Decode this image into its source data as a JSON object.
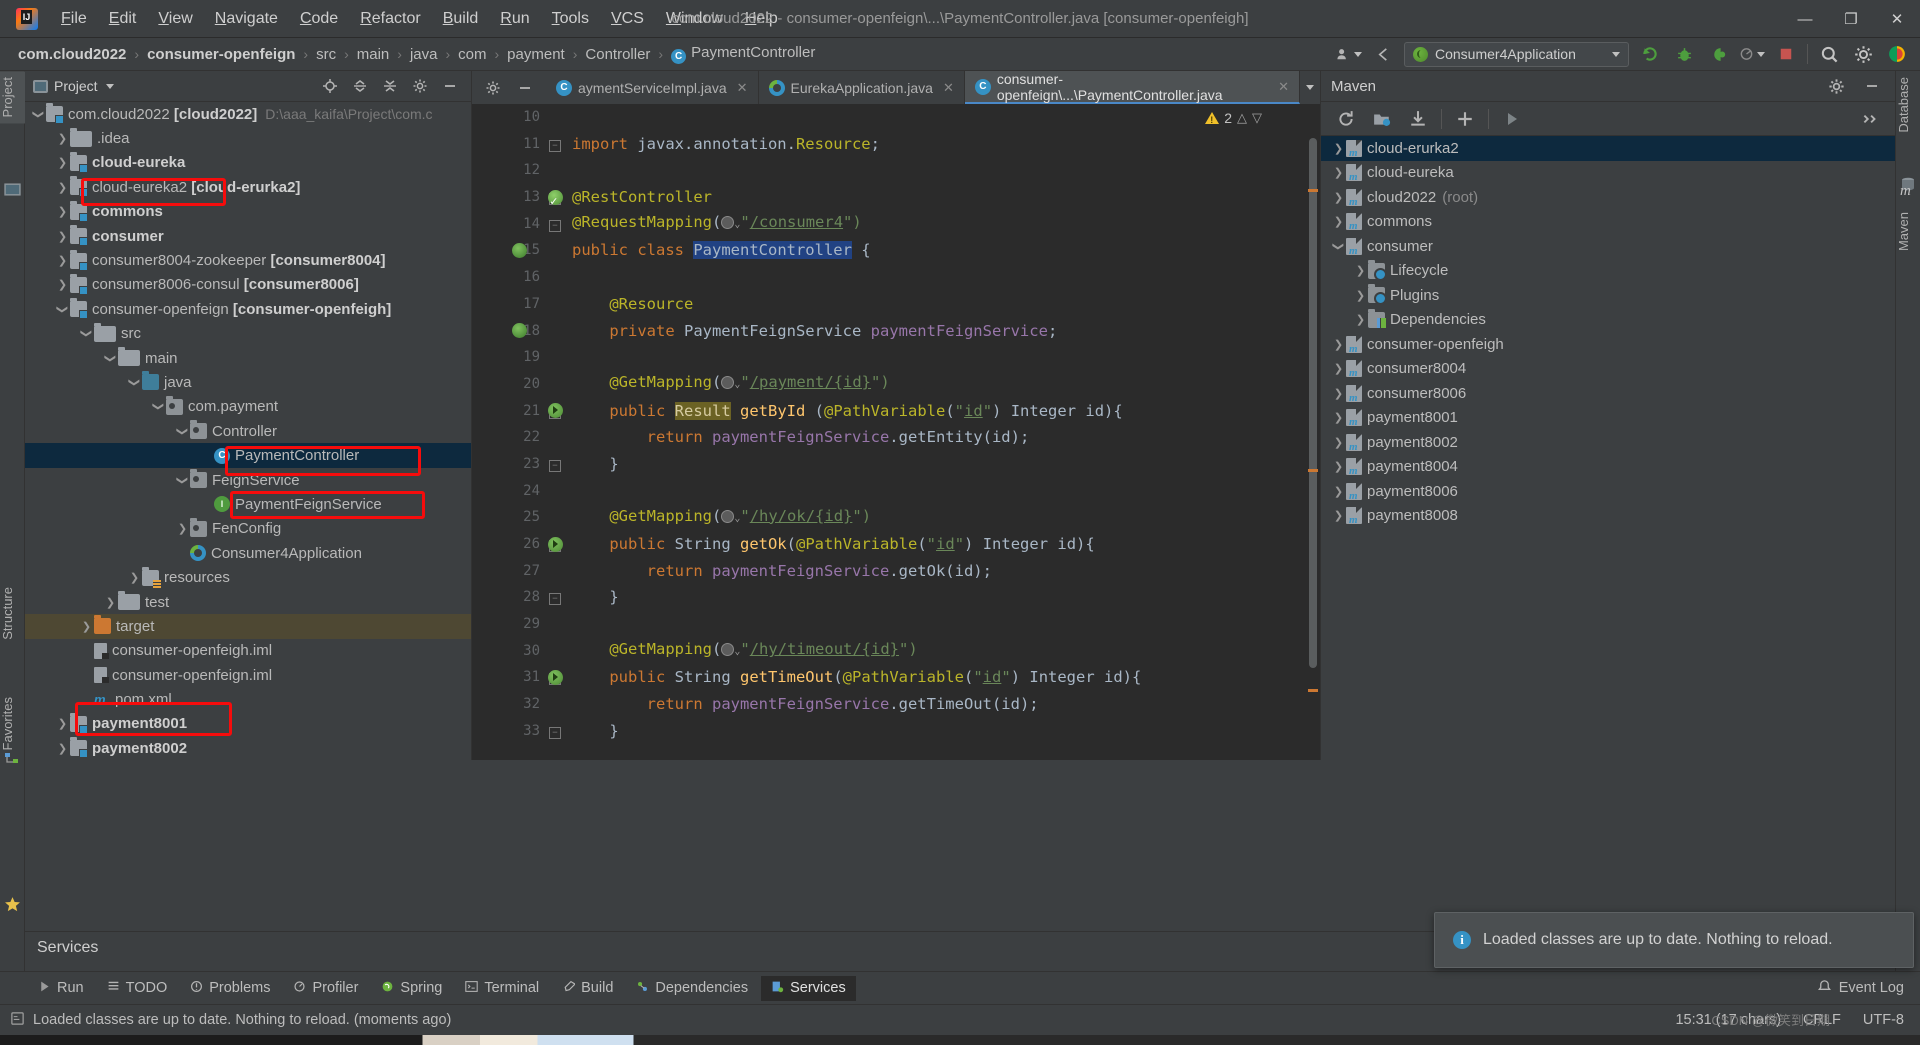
{
  "window": {
    "title": "com.cloud2022 - consumer-openfeign\\...\\PaymentController.java [consumer-openfeigh]",
    "minimize": "—",
    "maximize": "❐",
    "close": "✕"
  },
  "menu": [
    {
      "label": "File"
    },
    {
      "label": "Edit"
    },
    {
      "label": "View"
    },
    {
      "label": "Navigate"
    },
    {
      "label": "Code"
    },
    {
      "label": "Refactor"
    },
    {
      "label": "Build"
    },
    {
      "label": "Run"
    },
    {
      "label": "Tools"
    },
    {
      "label": "VCS"
    },
    {
      "label": "Window"
    },
    {
      "label": "Help"
    }
  ],
  "breadcrumbs": [
    {
      "label": "com.cloud2022",
      "bold": true
    },
    {
      "label": "consumer-openfeign",
      "bold": true
    },
    {
      "label": "src",
      "bold": false
    },
    {
      "label": "main",
      "bold": false
    },
    {
      "label": "java",
      "bold": false
    },
    {
      "label": "com",
      "bold": false
    },
    {
      "label": "payment",
      "bold": false
    },
    {
      "label": "Controller",
      "bold": false
    },
    {
      "label": "PaymentController",
      "bold": false,
      "icon": "class-icon"
    }
  ],
  "toolbar": {
    "run_config": "Consumer4Application",
    "icons": [
      "user-icon",
      "back-arrow-icon",
      "rerun-icon",
      "debug-icon",
      "coverage-icon",
      "profiler-icon",
      "stop-icon",
      "search-icon",
      "settings-icon",
      "ide-icon"
    ]
  },
  "left_strip": {
    "tabs": [
      "Project",
      "Structure",
      "Favorites"
    ],
    "bottom_icons": [
      "bookmark-star-icon"
    ]
  },
  "right_strip": {
    "tabs": [
      "Database",
      "Maven"
    ]
  },
  "project_panel": {
    "title": "Project",
    "header_icons": [
      "locate-icon",
      "expand-all-icon",
      "collapse-all-icon",
      "gear-icon",
      "hide-icon"
    ],
    "tree": [
      {
        "indent": 0,
        "arrow": "down",
        "icon": "module-icon",
        "label": "com.cloud2022 [cloud2022]",
        "bold_part": "[cloud2022]",
        "path": "D:\\aaa_kaifa\\Project\\com.c"
      },
      {
        "indent": 1,
        "arrow": "right",
        "icon": "folder-icon",
        "label": ".idea"
      },
      {
        "indent": 1,
        "arrow": "right",
        "icon": "module-icon",
        "label": "cloud-eureka",
        "bold": true,
        "highlight": true
      },
      {
        "indent": 1,
        "arrow": "right",
        "icon": "module-icon",
        "label": "cloud-eureka2 [cloud-erurka2]"
      },
      {
        "indent": 1,
        "arrow": "right",
        "icon": "module-icon",
        "label": "commons",
        "bold": true
      },
      {
        "indent": 1,
        "arrow": "right",
        "icon": "module-icon",
        "label": "consumer",
        "bold": true
      },
      {
        "indent": 1,
        "arrow": "right",
        "icon": "module-icon",
        "label": "consumer8004-zookeeper [consumer8004]"
      },
      {
        "indent": 1,
        "arrow": "right",
        "icon": "module-icon",
        "label": "consumer8006-consul [consumer8006]"
      },
      {
        "indent": 1,
        "arrow": "down",
        "icon": "module-icon",
        "label": "consumer-openfeign [consumer-openfeigh]"
      },
      {
        "indent": 2,
        "arrow": "down",
        "icon": "folder-icon",
        "label": "src"
      },
      {
        "indent": 3,
        "arrow": "down",
        "icon": "folder-icon",
        "label": "main"
      },
      {
        "indent": 4,
        "arrow": "down",
        "icon": "source-icon",
        "label": "java"
      },
      {
        "indent": 5,
        "arrow": "down",
        "icon": "package-icon",
        "label": "com.payment"
      },
      {
        "indent": 6,
        "arrow": "down",
        "icon": "package-icon",
        "label": "Controller"
      },
      {
        "indent": 7,
        "arrow": "none",
        "icon": "class-icon",
        "label": "PaymentController",
        "selected": true,
        "highlight": true
      },
      {
        "indent": 6,
        "arrow": "down",
        "icon": "package-icon",
        "label": "FeignService"
      },
      {
        "indent": 7,
        "arrow": "none",
        "icon": "interface-icon",
        "label": "PaymentFeignService",
        "highlight": true
      },
      {
        "indent": 6,
        "arrow": "right",
        "icon": "package-icon",
        "label": "FenConfig"
      },
      {
        "indent": 6,
        "arrow": "none",
        "icon": "spring-app-icon",
        "label": "Consumer4Application"
      },
      {
        "indent": 4,
        "arrow": "right",
        "icon": "resources-icon",
        "label": "resources"
      },
      {
        "indent": 3,
        "arrow": "right",
        "icon": "folder-icon",
        "label": "test"
      },
      {
        "indent": 2,
        "arrow": "right",
        "icon": "target-icon",
        "label": "target",
        "target_hl": true
      },
      {
        "indent": 2,
        "arrow": "none",
        "icon": "iml-icon",
        "label": "consumer-openfeigh.iml"
      },
      {
        "indent": 2,
        "arrow": "none",
        "icon": "iml-icon",
        "label": "consumer-openfeign.iml"
      },
      {
        "indent": 2,
        "arrow": "none",
        "icon": "pom-icon",
        "label": "pom.xml"
      },
      {
        "indent": 1,
        "arrow": "right",
        "icon": "module-icon",
        "label": "payment8001",
        "bold": true,
        "highlight": true
      },
      {
        "indent": 1,
        "arrow": "right",
        "icon": "module-icon",
        "label": "payment8002",
        "bold": true
      }
    ]
  },
  "editor": {
    "tabs": [
      {
        "label": "aymentServiceImpl.java",
        "icon": "class-icon",
        "active": false,
        "closable": true
      },
      {
        "label": "EurekaApplication.java",
        "icon": "spring-app-icon",
        "active": false,
        "closable": true
      },
      {
        "label": "consumer-openfeign\\...\\PaymentController.java",
        "icon": "class-icon",
        "active": true,
        "closable": true
      }
    ],
    "warning_count": "2",
    "lines": [
      {
        "n": "10",
        "segments": [],
        "mark": null,
        "fold": null
      },
      {
        "n": "11",
        "segments": [
          {
            "t": "import ",
            "c": "kw"
          },
          {
            "t": "javax.annotation.",
            "c": "plain"
          },
          {
            "t": "Resource",
            "c": "ann"
          },
          {
            "t": ";",
            "c": "plain"
          }
        ],
        "mark": null,
        "fold": "minus"
      },
      {
        "n": "12",
        "segments": [],
        "mark": null,
        "fold": null
      },
      {
        "n": "13",
        "segments": [
          {
            "t": "@RestController",
            "c": "ann"
          }
        ],
        "mark": "green-check",
        "fold": "minus"
      },
      {
        "n": "14",
        "segments": [
          {
            "t": "@RequestMapping",
            "c": "ann"
          },
          {
            "t": "(",
            "c": "plain"
          },
          {
            "t": "GLOBE",
            "c": "globe"
          },
          {
            "t": "\"",
            "c": "str"
          },
          {
            "t": "/consumer4",
            "c": "ustr"
          },
          {
            "t": "\")",
            "c": "str"
          }
        ],
        "mark": null,
        "fold": "minus"
      },
      {
        "n": "15",
        "segments": [
          {
            "t": "public class ",
            "c": "kw"
          },
          {
            "t": "PaymentController",
            "c": "sel"
          },
          {
            "t": " {",
            "c": "plain"
          }
        ],
        "mark": "green-bean",
        "fold": null
      },
      {
        "n": "16",
        "segments": [],
        "mark": null,
        "fold": null
      },
      {
        "n": "17",
        "segments": [
          {
            "t": "    @Resource",
            "c": "ann"
          }
        ],
        "mark": null,
        "fold": null
      },
      {
        "n": "18",
        "segments": [
          {
            "t": "    private ",
            "c": "kw"
          },
          {
            "t": "PaymentFeignService ",
            "c": "plain"
          },
          {
            "t": "paymentFeignService",
            "c": "fld"
          },
          {
            "t": ";",
            "c": "plain"
          }
        ],
        "mark": "green-bean",
        "fold": null
      },
      {
        "n": "19",
        "segments": [],
        "mark": null,
        "fold": null
      },
      {
        "n": "20",
        "segments": [
          {
            "t": "    @GetMapping",
            "c": "ann"
          },
          {
            "t": "(",
            "c": "plain"
          },
          {
            "t": "GLOBE",
            "c": "globe"
          },
          {
            "t": "\"",
            "c": "str"
          },
          {
            "t": "/payment/{id}",
            "c": "ustr"
          },
          {
            "t": "\")",
            "c": "str"
          }
        ],
        "mark": null,
        "fold": null
      },
      {
        "n": "21",
        "segments": [
          {
            "t": "    public ",
            "c": "kw"
          },
          {
            "t": "Result",
            "c": "hl"
          },
          {
            "t": " ",
            "c": "plain"
          },
          {
            "t": "getById ",
            "c": "mth"
          },
          {
            "t": "(",
            "c": "plain"
          },
          {
            "t": "@PathVariable",
            "c": "ann"
          },
          {
            "t": "(",
            "c": "plain"
          },
          {
            "t": "\"",
            "c": "str"
          },
          {
            "t": "id",
            "c": "ustr"
          },
          {
            "t": "\"",
            "c": "str"
          },
          {
            "t": ") ",
            "c": "plain"
          },
          {
            "t": "Integer ",
            "c": "plain"
          },
          {
            "t": "id){",
            "c": "plain"
          }
        ],
        "mark": "green-run",
        "fold": "minus"
      },
      {
        "n": "22",
        "segments": [
          {
            "t": "        return ",
            "c": "kw"
          },
          {
            "t": "paymentFeignService",
            "c": "fld"
          },
          {
            "t": ".getEntity(id);",
            "c": "plain"
          }
        ],
        "mark": null,
        "fold": null
      },
      {
        "n": "23",
        "segments": [
          {
            "t": "    }",
            "c": "plain"
          }
        ],
        "mark": null,
        "fold": "end"
      },
      {
        "n": "24",
        "segments": [],
        "mark": null,
        "fold": null
      },
      {
        "n": "25",
        "segments": [
          {
            "t": "    @GetMapping",
            "c": "ann"
          },
          {
            "t": "(",
            "c": "plain"
          },
          {
            "t": "GLOBE",
            "c": "globe"
          },
          {
            "t": "\"",
            "c": "str"
          },
          {
            "t": "/hy/ok/{id}",
            "c": "ustr"
          },
          {
            "t": "\")",
            "c": "str"
          }
        ],
        "mark": null,
        "fold": null
      },
      {
        "n": "26",
        "segments": [
          {
            "t": "    public ",
            "c": "kw"
          },
          {
            "t": "String ",
            "c": "plain"
          },
          {
            "t": "getOk",
            "c": "mth"
          },
          {
            "t": "(",
            "c": "plain"
          },
          {
            "t": "@PathVariable",
            "c": "ann"
          },
          {
            "t": "(",
            "c": "plain"
          },
          {
            "t": "\"",
            "c": "str"
          },
          {
            "t": "id",
            "c": "ustr"
          },
          {
            "t": "\"",
            "c": "str"
          },
          {
            "t": ") ",
            "c": "plain"
          },
          {
            "t": "Integer ",
            "c": "plain"
          },
          {
            "t": "id){",
            "c": "plain"
          }
        ],
        "mark": "green-run",
        "fold": "minus"
      },
      {
        "n": "27",
        "segments": [
          {
            "t": "        return ",
            "c": "kw"
          },
          {
            "t": "paymentFeignService",
            "c": "fld"
          },
          {
            "t": ".getOk(id);",
            "c": "plain"
          }
        ],
        "mark": null,
        "fold": null
      },
      {
        "n": "28",
        "segments": [
          {
            "t": "    }",
            "c": "plain"
          }
        ],
        "mark": null,
        "fold": "end"
      },
      {
        "n": "29",
        "segments": [],
        "mark": null,
        "fold": null
      },
      {
        "n": "30",
        "segments": [
          {
            "t": "    @GetMapping",
            "c": "ann"
          },
          {
            "t": "(",
            "c": "plain"
          },
          {
            "t": "GLOBE",
            "c": "globe"
          },
          {
            "t": "\"",
            "c": "str"
          },
          {
            "t": "/hy/timeout/{id}",
            "c": "ustr"
          },
          {
            "t": "\")",
            "c": "str"
          }
        ],
        "mark": null,
        "fold": null
      },
      {
        "n": "31",
        "segments": [
          {
            "t": "    public ",
            "c": "kw"
          },
          {
            "t": "String ",
            "c": "plain"
          },
          {
            "t": "getTimeOut",
            "c": "mth"
          },
          {
            "t": "(",
            "c": "plain"
          },
          {
            "t": "@PathVariable",
            "c": "ann"
          },
          {
            "t": "(",
            "c": "plain"
          },
          {
            "t": "\"",
            "c": "str"
          },
          {
            "t": "id",
            "c": "ustr"
          },
          {
            "t": "\"",
            "c": "str"
          },
          {
            "t": ") ",
            "c": "plain"
          },
          {
            "t": "Integer ",
            "c": "plain"
          },
          {
            "t": "id){",
            "c": "plain"
          }
        ],
        "mark": "green-run",
        "fold": "minus"
      },
      {
        "n": "32",
        "segments": [
          {
            "t": "        return ",
            "c": "kw"
          },
          {
            "t": "paymentFeignService",
            "c": "fld"
          },
          {
            "t": ".getTimeOut(id);",
            "c": "plain"
          }
        ],
        "mark": null,
        "fold": null
      },
      {
        "n": "33",
        "segments": [
          {
            "t": "    }",
            "c": "plain"
          }
        ],
        "mark": null,
        "fold": "end"
      }
    ]
  },
  "maven_panel": {
    "title": "Maven",
    "toolbar_icons": [
      "reload-icon",
      "add-module-icon",
      "download-sources-icon",
      "plus-icon",
      "run-icon",
      "more-icon"
    ],
    "header_icons": [
      "gear-icon",
      "hide-icon"
    ],
    "tree": [
      {
        "indent": 0,
        "arrow": "right",
        "icon": "maven-icon",
        "label": "cloud-erurka2",
        "selected": true
      },
      {
        "indent": 0,
        "arrow": "right",
        "icon": "maven-icon",
        "label": "cloud-eureka"
      },
      {
        "indent": 0,
        "arrow": "right",
        "icon": "maven-icon",
        "label": "cloud2022",
        "suffix": "(root)"
      },
      {
        "indent": 0,
        "arrow": "right",
        "icon": "maven-icon",
        "label": "commons"
      },
      {
        "indent": 0,
        "arrow": "down",
        "icon": "maven-icon",
        "label": "consumer"
      },
      {
        "indent": 1,
        "arrow": "right",
        "icon": "lifecycle-icon",
        "label": "Lifecycle"
      },
      {
        "indent": 1,
        "arrow": "right",
        "icon": "lifecycle-icon",
        "label": "Plugins"
      },
      {
        "indent": 1,
        "arrow": "right",
        "icon": "dependencies-icon",
        "label": "Dependencies"
      },
      {
        "indent": 0,
        "arrow": "right",
        "icon": "maven-icon",
        "label": "consumer-openfeigh"
      },
      {
        "indent": 0,
        "arrow": "right",
        "icon": "maven-icon",
        "label": "consumer8004"
      },
      {
        "indent": 0,
        "arrow": "right",
        "icon": "maven-icon",
        "label": "consumer8006"
      },
      {
        "indent": 0,
        "arrow": "right",
        "icon": "maven-icon",
        "label": "payment8001"
      },
      {
        "indent": 0,
        "arrow": "right",
        "icon": "maven-icon",
        "label": "payment8002"
      },
      {
        "indent": 0,
        "arrow": "right",
        "icon": "maven-icon",
        "label": "payment8004"
      },
      {
        "indent": 0,
        "arrow": "right",
        "icon": "maven-icon",
        "label": "payment8006"
      },
      {
        "indent": 0,
        "arrow": "right",
        "icon": "maven-icon",
        "label": "payment8008"
      }
    ]
  },
  "notification": {
    "icon": "info-icon",
    "text": "Loaded classes are up to date. Nothing to reload."
  },
  "services_bar": {
    "label": "Services",
    "icon": "star-icon"
  },
  "tool_window_bar": {
    "items": [
      {
        "label": "Run",
        "icon": "run-icon",
        "active": false
      },
      {
        "label": "TODO",
        "icon": "todo-icon",
        "active": false
      },
      {
        "label": "Problems",
        "icon": "problems-icon",
        "active": false
      },
      {
        "label": "Profiler",
        "icon": "profiler-icon",
        "active": false
      },
      {
        "label": "Spring",
        "icon": "spring-icon",
        "active": false
      },
      {
        "label": "Terminal",
        "icon": "terminal-icon",
        "active": false
      },
      {
        "label": "Build",
        "icon": "build-icon",
        "active": false
      },
      {
        "label": "Dependencies",
        "icon": "dependencies-icon",
        "active": false
      },
      {
        "label": "Services",
        "icon": "services-icon",
        "active": true
      }
    ],
    "event_log": {
      "label": "Event Log",
      "icon": "event-log-icon"
    }
  },
  "status_bar": {
    "message": "Loaded classes are up to date. Nothing to reload. (moments ago)",
    "icon": "console-icon",
    "position": "15:31 (17 chars)",
    "line_separator": "CRLF",
    "encoding": "UTF-8",
    "watermark": "CSDN @微笑到日期"
  },
  "colors": {
    "accent_blue": "#3592c4",
    "annotation_red": "#f60c0c",
    "selection_blue": "#0d293e",
    "keyword_orange": "#cc7832",
    "string_green": "#6a8759",
    "annotation_yellow": "#bbb529",
    "field_purple": "#9876aa",
    "method_yellow": "#ffc66d",
    "editor_bg": "#2b2b2b",
    "panel_bg": "#3c3f41"
  }
}
